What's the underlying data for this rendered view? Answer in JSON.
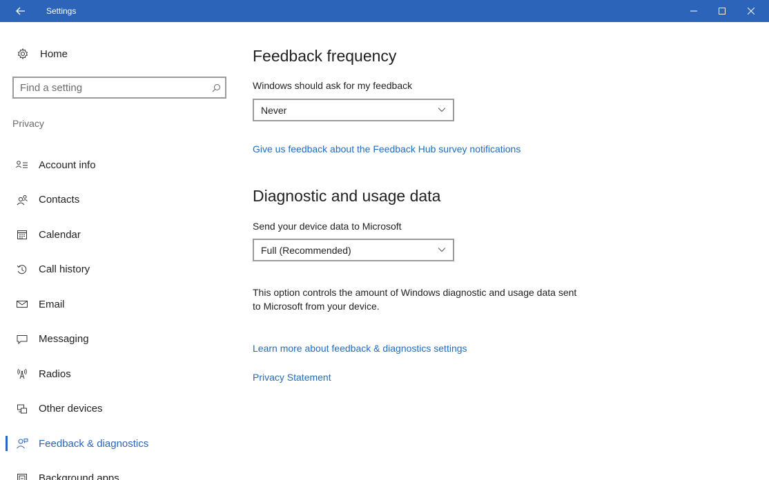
{
  "window": {
    "title": "Settings",
    "controls": {
      "minimize": "—",
      "maximize": "☐",
      "close": "✕"
    },
    "accent_color": "#2b64b8"
  },
  "sidebar": {
    "home_label": "Home",
    "search_placeholder": "Find a setting",
    "section_title": "Privacy",
    "items": [
      {
        "label": "Account info",
        "icon": "account-info-icon"
      },
      {
        "label": "Contacts",
        "icon": "contacts-icon"
      },
      {
        "label": "Calendar",
        "icon": "calendar-icon"
      },
      {
        "label": "Call history",
        "icon": "call-history-icon"
      },
      {
        "label": "Email",
        "icon": "email-icon"
      },
      {
        "label": "Messaging",
        "icon": "messaging-icon"
      },
      {
        "label": "Radios",
        "icon": "radios-icon"
      },
      {
        "label": "Other devices",
        "icon": "other-devices-icon"
      },
      {
        "label": "Feedback & diagnostics",
        "icon": "feedback-icon",
        "active": true
      },
      {
        "label": "Background apps",
        "icon": "background-apps-icon"
      }
    ]
  },
  "main": {
    "feedback": {
      "heading": "Feedback frequency",
      "label": "Windows should ask for my feedback",
      "selected": "Never",
      "link": "Give us feedback about the Feedback Hub survey notifications"
    },
    "diagnostic": {
      "heading": "Diagnostic and usage data",
      "label": "Send your device data to Microsoft",
      "selected": "Full (Recommended)",
      "description": "This option controls the amount of Windows diagnostic and usage data sent to Microsoft from your device.",
      "link_learn": "Learn more about feedback & diagnostics settings",
      "link_privacy": "Privacy Statement"
    },
    "link_color": "#1f6bbf"
  }
}
